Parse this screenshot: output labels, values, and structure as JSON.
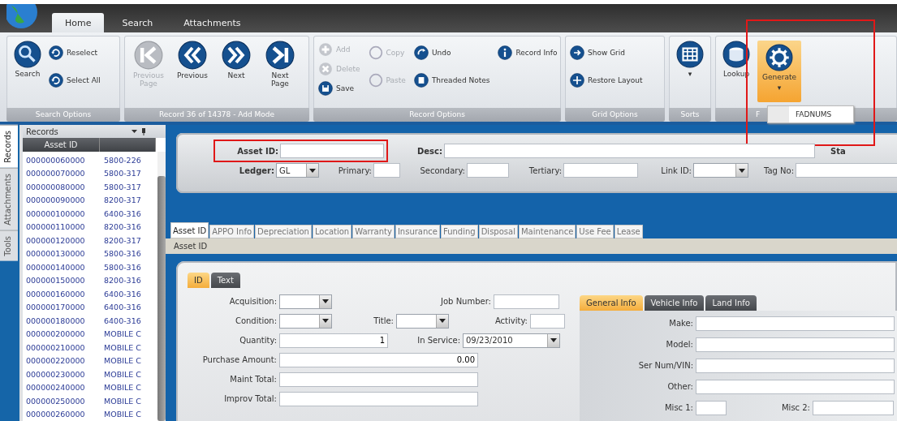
{
  "app_tabs": [
    {
      "label": "Home",
      "selected": true
    },
    {
      "label": "Search",
      "selected": false
    },
    {
      "label": "Attachments",
      "selected": false
    }
  ],
  "ribbon": {
    "search_options": {
      "label": "Search Options",
      "buttons": [
        "Search",
        "Reselect",
        "Select All"
      ]
    },
    "navigation": {
      "label": "Record 36 of 14378 - Add Mode",
      "buttons": [
        {
          "label": "Previous Page",
          "disabled": true
        },
        {
          "label": "Previous",
          "disabled": false
        },
        {
          "label": "Next",
          "disabled": false
        },
        {
          "label": "Next Page",
          "disabled": false
        }
      ]
    },
    "record_options": {
      "label": "Record Options",
      "columns": [
        [
          {
            "label": "Add",
            "disabled": true
          },
          {
            "label": "Delete",
            "disabled": true
          },
          {
            "label": "Save",
            "disabled": false
          }
        ],
        [
          {
            "label": "Copy",
            "disabled": true
          },
          {
            "label": "Paste",
            "disabled": true
          }
        ],
        [
          {
            "label": "Undo",
            "disabled": false
          },
          {
            "label": "Threaded Notes",
            "disabled": false
          }
        ],
        [
          {
            "label": "Record Info",
            "disabled": false
          }
        ]
      ]
    },
    "grid_options": {
      "label": "Grid Options",
      "buttons": [
        "Show Grid",
        "Restore Layout"
      ]
    },
    "sorts": {
      "label": "Sorts",
      "caret": "▾"
    },
    "tools": {
      "label": "F",
      "lookup": "Lookup",
      "generate": {
        "label": "Generate",
        "caret": "▾",
        "active": true,
        "highlighted": true
      },
      "menu": [
        "FADNUMS"
      ]
    }
  },
  "side_tabs": [
    {
      "label": "Records",
      "selected": true
    },
    {
      "label": "Attachments",
      "selected": false
    },
    {
      "label": "Tools",
      "selected": false
    }
  ],
  "records": {
    "title": "Records",
    "columns": [
      "Asset ID"
    ],
    "rows": [
      [
        "000000060000",
        "5800-226"
      ],
      [
        "000000070000",
        "5800-317"
      ],
      [
        "000000080000",
        "5800-317"
      ],
      [
        "000000090000",
        "8200-317"
      ],
      [
        "000000100000",
        "6400-316"
      ],
      [
        "000000110000",
        "8200-316"
      ],
      [
        "000000120000",
        "8200-317"
      ],
      [
        "000000130000",
        "5800-316"
      ],
      [
        "000000140000",
        "5800-316"
      ],
      [
        "000000150000",
        "8200-316"
      ],
      [
        "000000160000",
        "6400-316"
      ],
      [
        "000000170000",
        "6400-316"
      ],
      [
        "000000180000",
        "6400-316"
      ],
      [
        "000000200000",
        "MOBILE C"
      ],
      [
        "000000210000",
        "MOBILE C"
      ],
      [
        "000000220000",
        "MOBILE C"
      ],
      [
        "000000230000",
        "MOBILE C"
      ],
      [
        "000000240000",
        "MOBILE C"
      ],
      [
        "000000250000",
        "MOBILE C"
      ],
      [
        "000000260000",
        "MOBILE C"
      ]
    ]
  },
  "header_form": {
    "top_fields": [
      {
        "kind": "text",
        "label": "Asset ID:",
        "required": true,
        "highlighted": true
      },
      {
        "kind": "text",
        "label": "Desc:",
        "required": true
      }
    ],
    "status_label": "Sta",
    "bottom_fields": [
      {
        "kind": "select",
        "label": "Ledger:",
        "value": "GL",
        "required": true
      },
      {
        "kind": "text",
        "label": "Primary:",
        "required": false
      },
      {
        "kind": "text",
        "label": "Secondary:",
        "required": false
      },
      {
        "kind": "text",
        "label": "Tertiary:",
        "required": false
      },
      {
        "kind": "select",
        "label": "Link ID:",
        "required": false
      },
      {
        "kind": "text",
        "label": "Tag No:",
        "required": false
      }
    ]
  },
  "record_tabs": [
    {
      "label": "Asset ID",
      "selected": true
    },
    {
      "label": "APPO Info",
      "selected": false
    },
    {
      "label": "Depreciation",
      "selected": false
    },
    {
      "label": "Location",
      "selected": false
    },
    {
      "label": "Warranty",
      "selected": false
    },
    {
      "label": "Insurance",
      "selected": false
    },
    {
      "label": "Funding",
      "selected": false
    },
    {
      "label": "Disposal",
      "selected": false
    },
    {
      "label": "Maintenance",
      "selected": false
    },
    {
      "label": "Use Fee",
      "selected": false
    },
    {
      "label": "Lease",
      "selected": false
    }
  ],
  "section_title": "Asset ID",
  "detail_tabs": [
    {
      "label": "ID",
      "selected": true
    },
    {
      "label": "Text",
      "selected": false
    }
  ],
  "detail_form": {
    "rows": [
      [
        {
          "kind": "select",
          "label": "Acquisition:"
        },
        {
          "kind": "text",
          "label": "Job Number:"
        }
      ],
      [
        {
          "kind": "select",
          "label": "Condition:"
        },
        {
          "kind": "select",
          "label": "Title:"
        },
        {
          "kind": "text",
          "label": "Activity:"
        }
      ],
      [
        {
          "kind": "number",
          "label": "Quantity:",
          "value": "1"
        },
        {
          "kind": "date",
          "label": "In Service:",
          "value": "09/23/2010"
        }
      ],
      [
        {
          "kind": "number",
          "label": "Purchase Amount:",
          "value": "0.00"
        }
      ],
      [
        {
          "kind": "text",
          "label": "Maint Total:"
        }
      ],
      [
        {
          "kind": "text",
          "label": "Improv Total:"
        }
      ]
    ]
  },
  "info_tabs": [
    {
      "label": "General Info",
      "selected": true
    },
    {
      "label": "Vehicle Info",
      "selected": false
    },
    {
      "label": "Land Info",
      "selected": false
    }
  ],
  "info_form": {
    "rows": [
      [
        {
          "kind": "text",
          "label": "Make:"
        }
      ],
      [
        {
          "kind": "text",
          "label": "Model:"
        }
      ],
      [
        {
          "kind": "text",
          "label": "Ser Num/VIN:"
        }
      ],
      [
        {
          "kind": "text",
          "label": "Other:"
        }
      ],
      [
        {
          "kind": "text",
          "label": "Misc 1:"
        },
        {
          "kind": "text",
          "label": "Misc 2:"
        }
      ]
    ]
  }
}
